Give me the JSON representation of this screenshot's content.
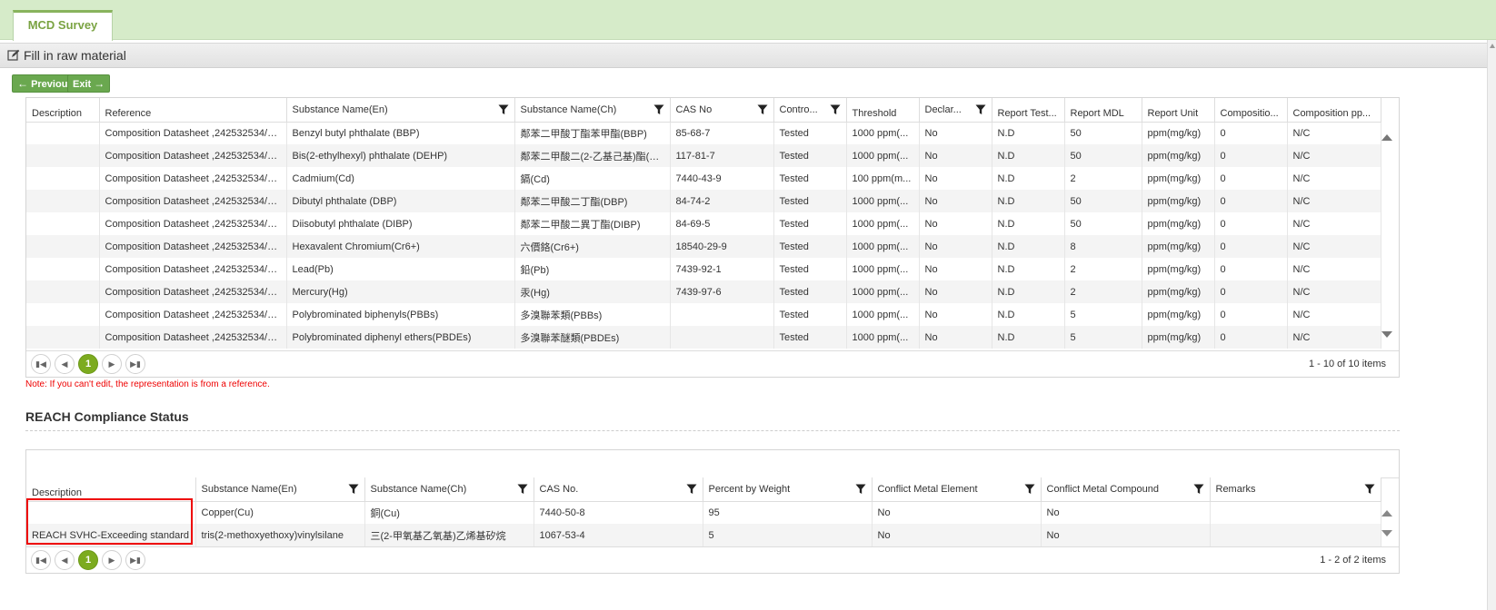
{
  "tab": "MCD Survey",
  "title": "Fill in raw material",
  "buttons": {
    "previous": "Previous",
    "exit": "Exit"
  },
  "grid1": {
    "headers": [
      "Description",
      "Reference",
      "Substance Name(En)",
      "Substance Name(Ch)",
      "CAS No",
      "Contro...",
      "Threshold",
      "Declar...",
      "Report Test...",
      "Report MDL",
      "Report Unit",
      "Compositio...",
      "Composition pp..."
    ],
    "rows": [
      [
        "",
        "Composition Datasheet ,242532534/Pl...",
        "Benzyl butyl phthalate (BBP)",
        "鄰苯二甲酸丁酯苯甲酯(BBP)",
        "85-68-7",
        "Tested",
        "1000 ppm(...",
        "No",
        "N.D",
        "50",
        "ppm(mg/kg)",
        "0",
        "N/C"
      ],
      [
        "",
        "Composition Datasheet ,242532534/Pl...",
        "Bis(2-ethylhexyl) phthalate (DEHP)",
        "鄰苯二甲酸二(2-乙基己基)酯(D...",
        "117-81-7",
        "Tested",
        "1000 ppm(...",
        "No",
        "N.D",
        "50",
        "ppm(mg/kg)",
        "0",
        "N/C"
      ],
      [
        "",
        "Composition Datasheet ,242532534/Pl...",
        "Cadmium(Cd)",
        "鎘(Cd)",
        "7440-43-9",
        "Tested",
        "100 ppm(m...",
        "No",
        "N.D",
        "2",
        "ppm(mg/kg)",
        "0",
        "N/C"
      ],
      [
        "",
        "Composition Datasheet ,242532534/Pl...",
        "Dibutyl phthalate (DBP)",
        "鄰苯二甲酸二丁酯(DBP)",
        "84-74-2",
        "Tested",
        "1000 ppm(...",
        "No",
        "N.D",
        "50",
        "ppm(mg/kg)",
        "0",
        "N/C"
      ],
      [
        "",
        "Composition Datasheet ,242532534/Pl...",
        "Diisobutyl phthalate (DIBP)",
        "鄰苯二甲酸二異丁酯(DIBP)",
        "84-69-5",
        "Tested",
        "1000 ppm(...",
        "No",
        "N.D",
        "50",
        "ppm(mg/kg)",
        "0",
        "N/C"
      ],
      [
        "",
        "Composition Datasheet ,242532534/Pl...",
        "Hexavalent Chromium(Cr6+)",
        "六價鉻(Cr6+)",
        "18540-29-9",
        "Tested",
        "1000 ppm(...",
        "No",
        "N.D",
        "8",
        "ppm(mg/kg)",
        "0",
        "N/C"
      ],
      [
        "",
        "Composition Datasheet ,242532534/Pl...",
        "Lead(Pb)",
        "鉛(Pb)",
        "7439-92-1",
        "Tested",
        "1000 ppm(...",
        "No",
        "N.D",
        "2",
        "ppm(mg/kg)",
        "0",
        "N/C"
      ],
      [
        "",
        "Composition Datasheet ,242532534/Pl...",
        "Mercury(Hg)",
        "汞(Hg)",
        "7439-97-6",
        "Tested",
        "1000 ppm(...",
        "No",
        "N.D",
        "2",
        "ppm(mg/kg)",
        "0",
        "N/C"
      ],
      [
        "",
        "Composition Datasheet ,242532534/Pl...",
        "Polybrominated biphenyls(PBBs)",
        "多溴聯苯類(PBBs)",
        "",
        "Tested",
        "1000 ppm(...",
        "No",
        "N.D",
        "5",
        "ppm(mg/kg)",
        "0",
        "N/C"
      ],
      [
        "",
        "Composition Datasheet ,242532534/Pl...",
        "Polybrominated diphenyl ethers(PBDEs)",
        "多溴聯苯醚類(PBDEs)",
        "",
        "Tested",
        "1000 ppm(...",
        "No",
        "N.D",
        "5",
        "ppm(mg/kg)",
        "0",
        "N/C"
      ]
    ],
    "page": "1",
    "count": "1 - 10 of 10 items"
  },
  "note": "Note: If you can't edit, the representation is from a reference.",
  "section_title": "REACH Compliance Status",
  "grid2": {
    "headers": [
      "Description",
      "Substance Name(En)",
      "Substance Name(Ch)",
      "CAS No.",
      "Percent by Weight",
      "Conflict Metal Element",
      "Conflict Metal Compound",
      "Remarks"
    ],
    "rows": [
      [
        "",
        "Copper(Cu)",
        "銅(Cu)",
        "7440-50-8",
        "95",
        "No",
        "No",
        ""
      ],
      [
        "REACH SVHC-Exceeding standard",
        "tris(2-methoxyethoxy)vinylsilane",
        "三(2-甲氧基乙氧基)乙烯基矽烷",
        "1067-53-4",
        "5",
        "No",
        "No",
        ""
      ]
    ],
    "page": "1",
    "count": "1 - 2 of 2 items"
  }
}
